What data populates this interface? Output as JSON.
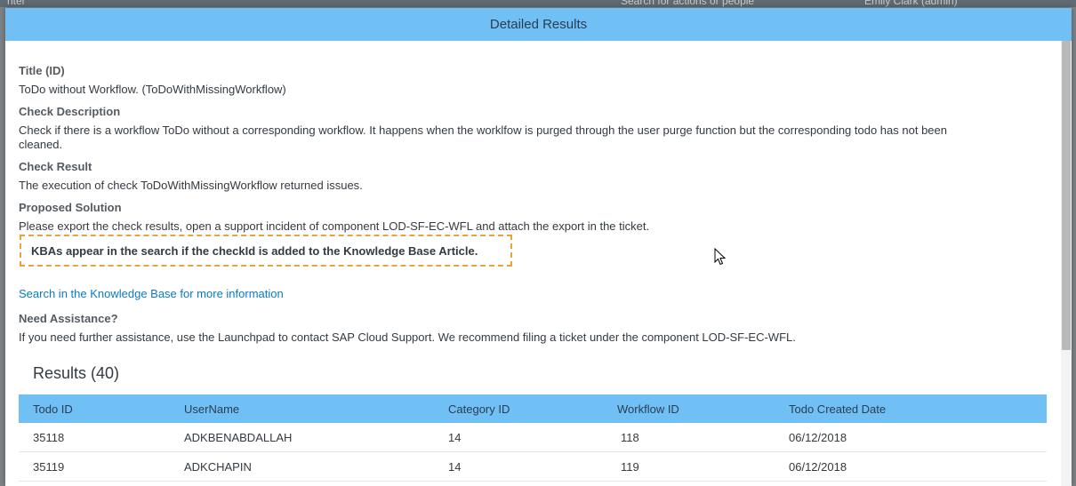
{
  "background": {
    "search_placeholder": "Search for actions or people",
    "user_label": "Emily Clark (admin)",
    "left_fragment": "nter"
  },
  "dialog": {
    "title": "Detailed Results"
  },
  "details": {
    "title_label": "Title (ID)",
    "title_value": "ToDo without Workflow. (ToDoWithMissingWorkflow)",
    "check_description_label": "Check Description",
    "check_description_line1": "Check if there is a workflow ToDo without a corresponding workflow. It happens when the worklfow is purged through the user purge function but the corresponding todo has not been",
    "check_description_line2": "cleaned.",
    "check_result_label": "Check Result",
    "check_result_value": "The execution of check ToDoWithMissingWorkflow returned issues.",
    "proposed_solution_label": "Proposed Solution",
    "proposed_solution_value": "Please export the check results, open a support incident of component LOD-SF-EC-WFL and attach the export in the ticket.",
    "kba_notice": "KBAs appear in the search if the checkId is added to the Knowledge Base Article.",
    "kb_link": "Search in the Knowledge Base for more information",
    "assistance_label": "Need Assistance?",
    "assistance_value": "If you need further assistance, use the Launchpad to contact SAP Cloud Support. We recommend filing a ticket under the component LOD-SF-EC-WFL."
  },
  "results": {
    "title": "Results (40)",
    "columns": [
      "Todo ID",
      "UserName",
      "Category ID",
      "Workflow ID",
      "Todo Created Date"
    ],
    "rows": [
      [
        "35118",
        "ADKBENABDALLAH",
        "14",
        "118",
        "06/12/2018"
      ],
      [
        "35119",
        "ADKCHAPIN",
        "14",
        "119",
        "06/12/2018"
      ]
    ]
  },
  "colors": {
    "header_blue": "#70bff5",
    "link_blue": "#0a7ac4",
    "highlight_orange": "#e8a33c"
  },
  "icons": {
    "cursor": "mouse-pointer-icon"
  }
}
